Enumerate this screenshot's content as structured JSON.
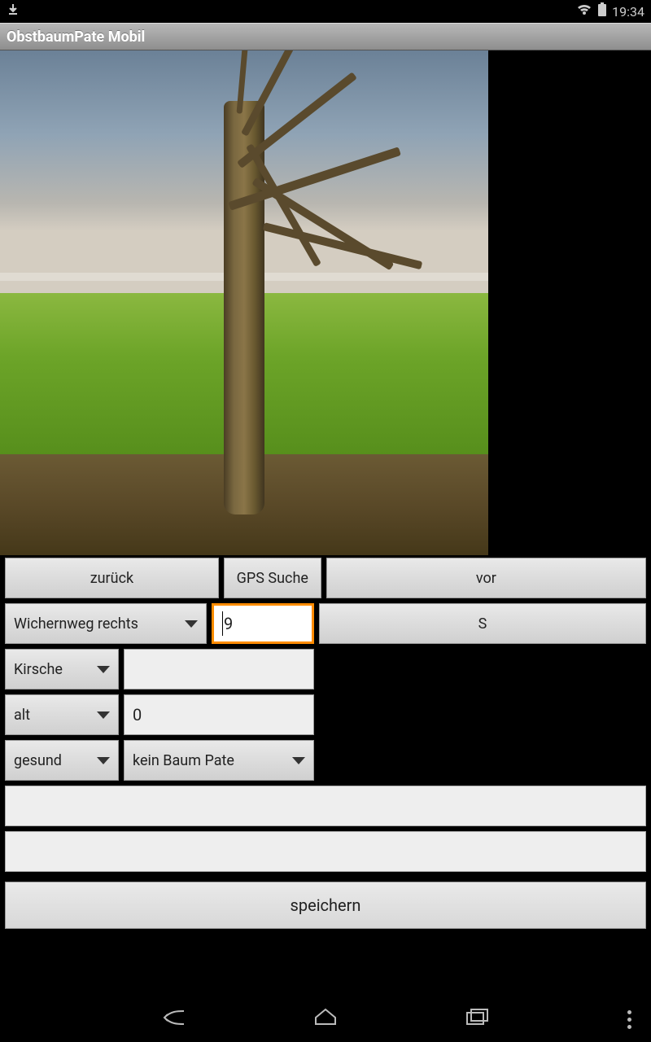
{
  "status": {
    "time": "19:34"
  },
  "app": {
    "title": "ObstbaumPate Mobil"
  },
  "nav": {
    "back": "zurück",
    "gps": "GPS Suche",
    "forward": "vor"
  },
  "row2": {
    "street": "Wichernweg rechts",
    "number": "9",
    "s": "S"
  },
  "row3": {
    "fruit": "Kirsche",
    "extra": ""
  },
  "row4": {
    "age": "alt",
    "value": "0"
  },
  "row5": {
    "health": "gesund",
    "pate": "kein Baum Pate"
  },
  "note1": "",
  "note2": "",
  "save": "speichern"
}
